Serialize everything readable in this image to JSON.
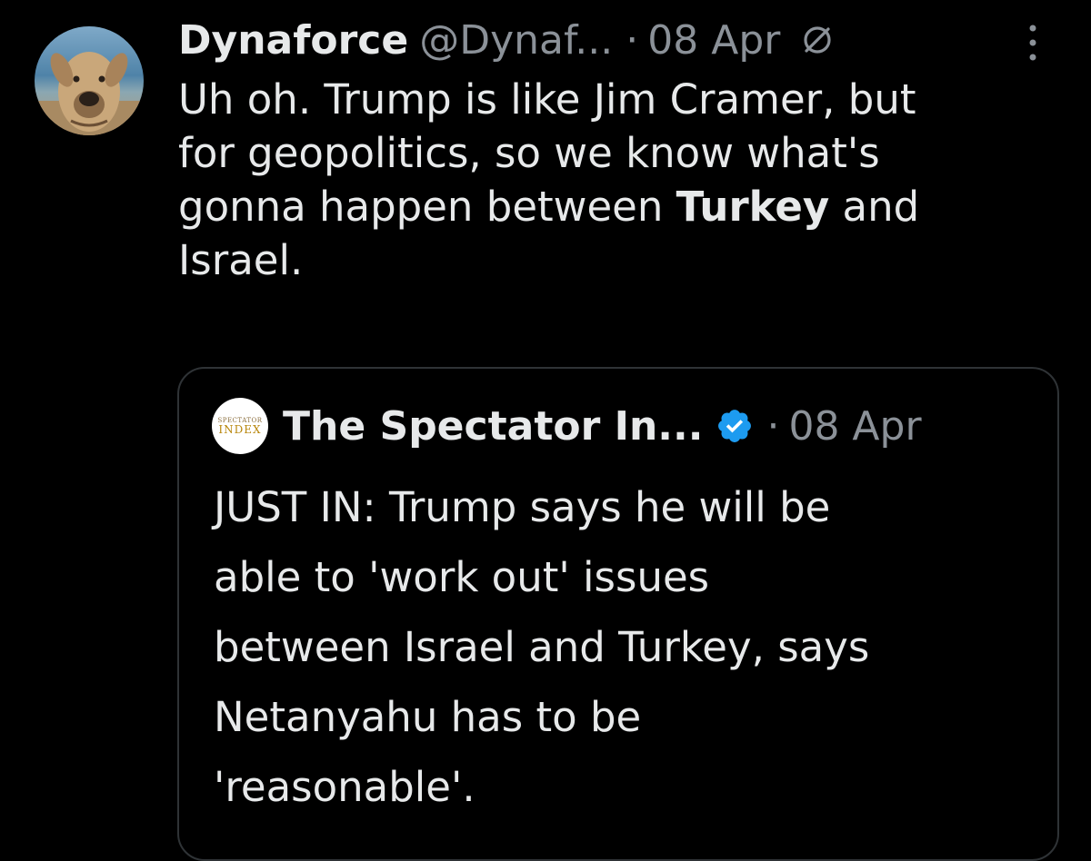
{
  "tweet": {
    "author": {
      "display_name": "Dynaforce",
      "handle": "@Dynaf...",
      "avatar": "dog-avatar"
    },
    "separator": "·",
    "date": "08 Apr",
    "status_icon": "no-entry-icon",
    "more_icon": "more-vertical-icon",
    "text_lines": [
      "Uh oh. Trump is like Jim Cramer, but",
      "for geopolitics, so we know what's",
      "gonna happen between ",
      "Turkey",
      " and",
      "Israel."
    ]
  },
  "quote": {
    "author": {
      "avatar_text_top": "SPECTATOR",
      "avatar_text_main": "INDEX",
      "display_name": "The Spectator In...",
      "verified_icon": "verified-badge-icon"
    },
    "separator": "·",
    "date": "08 Apr",
    "text_lines": [
      "JUST IN: Trump says he will be",
      "able to 'work out' issues",
      "between Israel and Turkey, says",
      "Netanyahu has to be",
      "'reasonable'."
    ]
  },
  "colors": {
    "background": "#000000",
    "text_primary": "#e7e9ea",
    "text_secondary": "#8b9198",
    "border": "#2f3336",
    "verified_blue": "#1d9bf0"
  }
}
